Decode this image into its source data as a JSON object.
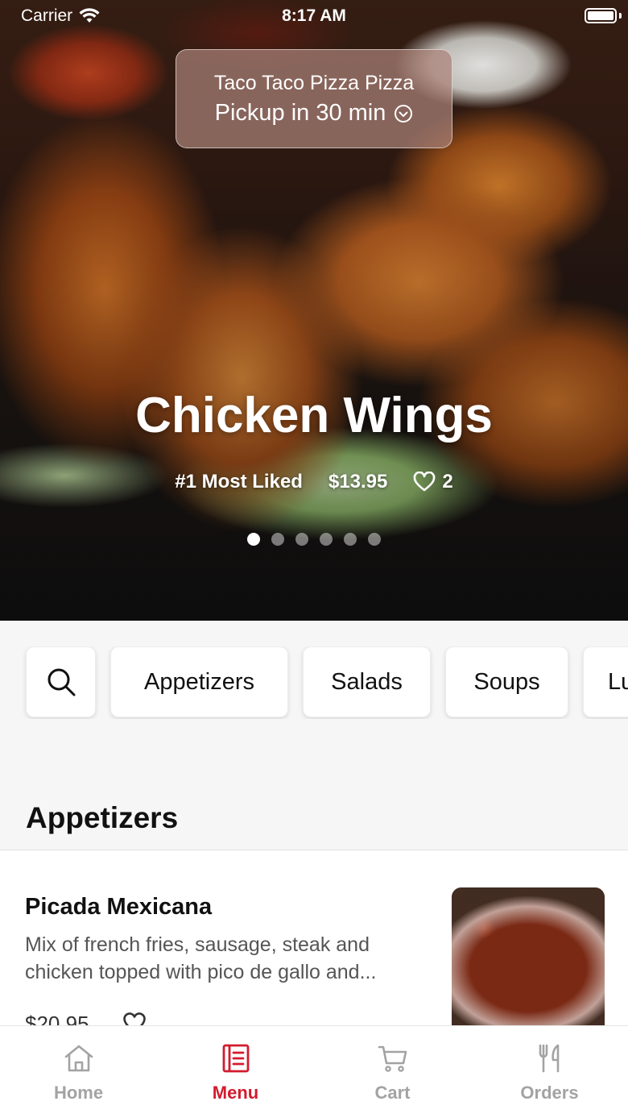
{
  "status_bar": {
    "carrier": "Carrier",
    "time": "8:17 AM"
  },
  "store": {
    "name": "Taco Taco Pizza Pizza",
    "pickup": "Pickup in 30 min"
  },
  "featured": {
    "title": "Chicken Wings",
    "badge": "#1 Most Liked",
    "price": "$13.95",
    "likes": "2",
    "slide_count": 6,
    "active_slide": 1
  },
  "categories": [
    "Appetizers",
    "Salads",
    "Soups",
    "Lu"
  ],
  "section": {
    "title": "Appetizers"
  },
  "items": [
    {
      "name": "Picada Mexicana",
      "description": "Mix of french fries, sausage, steak and chicken topped with pico de gallo and...",
      "price": "$20.95"
    }
  ],
  "tabs": [
    {
      "label": "Home",
      "icon": "home-icon"
    },
    {
      "label": "Menu",
      "icon": "menu-icon"
    },
    {
      "label": "Cart",
      "icon": "cart-icon"
    },
    {
      "label": "Orders",
      "icon": "utensils-icon"
    }
  ],
  "active_tab": "Menu",
  "colors": {
    "accent": "#d31b2e",
    "inactive": "#a3a3a3"
  }
}
